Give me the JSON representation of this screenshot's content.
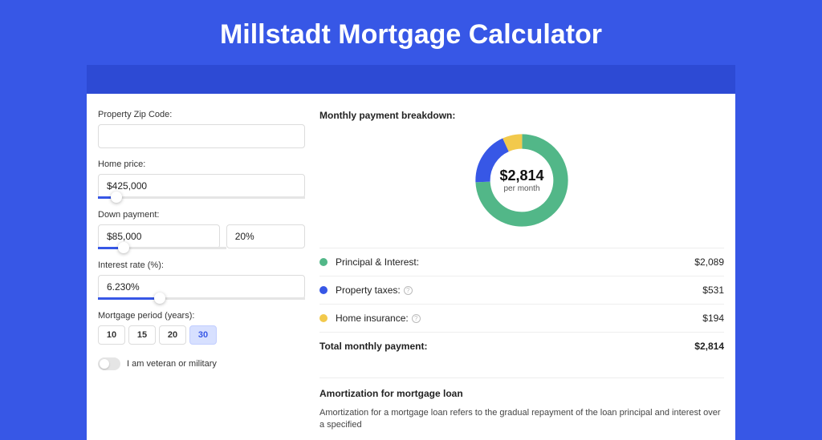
{
  "title": "Millstadt Mortgage Calculator",
  "form": {
    "zip_label": "Property Zip Code:",
    "zip_value": "",
    "home_price_label": "Home price:",
    "home_price_value": "$425,000",
    "home_price_slider_pct": 9,
    "down_payment_label": "Down payment:",
    "down_payment_amount": "$85,000",
    "down_payment_pct": "20%",
    "down_payment_slider_pct": 20,
    "interest_label": "Interest rate (%):",
    "interest_value": "6.230%",
    "interest_slider_pct": 30,
    "period_label": "Mortgage period (years):",
    "periods": [
      "10",
      "15",
      "20",
      "30"
    ],
    "period_selected": "30",
    "veteran_label": "I am veteran or military"
  },
  "breakdown": {
    "title": "Monthly payment breakdown:",
    "donut_main": "$2,814",
    "donut_sub": "per month",
    "items": [
      {
        "label": "Principal & Interest:",
        "value": "$2,089",
        "color": "#52b788",
        "info": false
      },
      {
        "label": "Property taxes:",
        "value": "$531",
        "color": "#3757e6",
        "info": true
      },
      {
        "label": "Home insurance:",
        "value": "$194",
        "color": "#f2c94c",
        "info": true
      }
    ],
    "total_label": "Total monthly payment:",
    "total_value": "$2,814"
  },
  "amortization": {
    "title": "Amortization for mortgage loan",
    "text": "Amortization for a mortgage loan refers to the gradual repayment of the loan principal and interest over a specified"
  },
  "chart_data": {
    "type": "pie",
    "title": "Monthly payment breakdown",
    "series": [
      {
        "name": "Principal & Interest",
        "value": 2089,
        "color": "#52b788"
      },
      {
        "name": "Property taxes",
        "value": 531,
        "color": "#3757e6"
      },
      {
        "name": "Home insurance",
        "value": 194,
        "color": "#f2c94c"
      }
    ],
    "total": 2814,
    "center_label": "$2,814 per month"
  }
}
